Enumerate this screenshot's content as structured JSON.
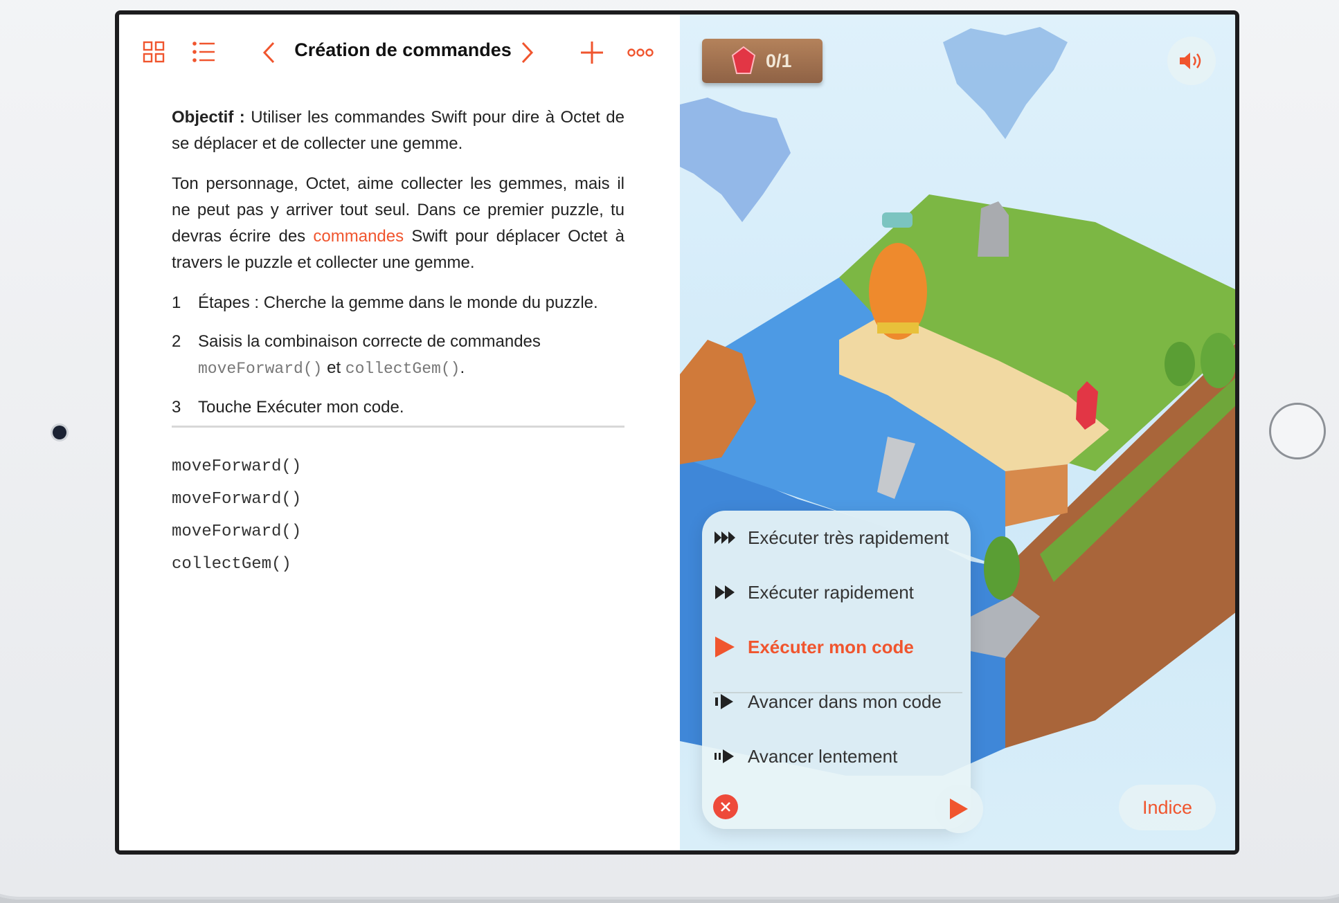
{
  "toolbar": {
    "title": "Création de commandes",
    "icons": [
      "grid-icon",
      "list-icon",
      "chevron-left-icon",
      "chevron-right-icon",
      "plus-icon",
      "more-icon"
    ]
  },
  "content": {
    "goal_label": "Objectif :",
    "goal_text": " Utiliser les commandes Swift pour dire à Octet de se déplacer et de collecter une gemme.",
    "intro_before": "Ton personnage, Octet, aime collecter les gemmes, mais il ne peut pas y arriver tout seul. Dans ce premier puzzle, tu devras écrire des ",
    "intro_keyword": "commandes",
    "intro_after": " Swift pour déplacer Octet à travers le puzzle et collecter une gemme.",
    "steps": [
      {
        "num": "1",
        "text": "Étapes : Cherche la gemme dans le monde du puzzle."
      },
      {
        "num": "2",
        "text_before": "Saisis la combinaison correcte de commandes ",
        "code1": "moveForward()",
        "mid": " et ",
        "code2": "collectGem()",
        "end": "."
      },
      {
        "num": "3",
        "text": "Touche Exécuter mon code."
      }
    ]
  },
  "code_lines": [
    "moveForward()",
    "moveForward()",
    "moveForward()",
    "collectGem()"
  ],
  "scene": {
    "gem_counter": "0/1",
    "run_menu": [
      {
        "label": "Exécuter très rapidement",
        "icon": "triple-forward-icon"
      },
      {
        "label": "Exécuter rapidement",
        "icon": "double-forward-icon"
      },
      {
        "label": "Exécuter mon code",
        "icon": "play-icon"
      },
      {
        "label": "Avancer dans mon code",
        "icon": "step-icon"
      },
      {
        "label": "Avancer lentement",
        "icon": "step-slow-icon"
      }
    ],
    "hint_label": "Indice"
  },
  "colors": {
    "accent": "#f0552e",
    "frame": "#1c1c1e",
    "sky": "#d6eefa"
  }
}
